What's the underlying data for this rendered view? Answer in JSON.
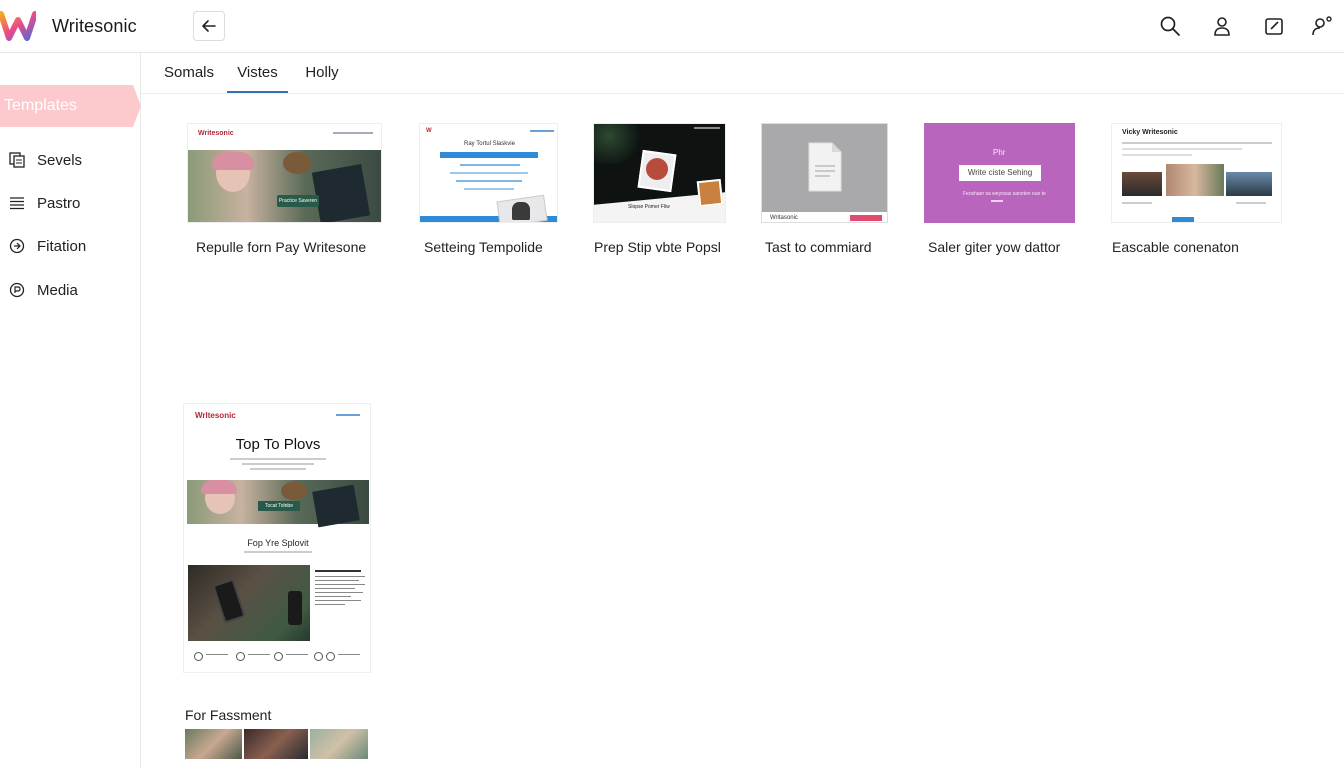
{
  "app": {
    "brand": "Writesonic",
    "brand_colors": [
      "#f6a623",
      "#e94a8b",
      "#4f6bd9"
    ]
  },
  "top_icons": [
    "search-icon",
    "user-icon",
    "edit-icon",
    "user-settings-icon"
  ],
  "sidebar": {
    "active_label": "Templates",
    "items": [
      {
        "label": "Sevels",
        "icon": "documents-icon"
      },
      {
        "label": "Pastro",
        "icon": "list-icon"
      },
      {
        "label": "Fitation",
        "icon": "compass-icon"
      },
      {
        "label": "Media",
        "icon": "media-icon"
      }
    ]
  },
  "tabs": [
    {
      "label": "Somals",
      "active": false
    },
    {
      "label": "Vistes",
      "active": true
    },
    {
      "label": "Holly",
      "active": false
    }
  ],
  "templates": [
    {
      "label": "Repulle forn Pay Writesone",
      "thumb_brand": "Writesonic",
      "thumb_button": "Practice Saveren"
    },
    {
      "label": "Setteing Tempolide",
      "thumb_title": "Ray Tortul Slaskvie"
    },
    {
      "label": "Prep Stip vbte Popsl",
      "thumb_caption": "Slopse Pomer Fliw"
    },
    {
      "label": "Tast to commiard",
      "thumb_footer": "Writasonic"
    },
    {
      "label": "Saler giter yow dattor",
      "thumb_top": "Phr",
      "thumb_box": "Write ciste Sehing",
      "thumb_caption": "Feoshaer sa weyssas sanoten oue te"
    },
    {
      "label": "Eascable conenaton",
      "thumb_brand": "Vicky Writesonic"
    }
  ],
  "feature_card": {
    "brand": "Wrltesonic",
    "title": "Top To Plovs",
    "subtitle": "Fop Yre Splovit",
    "button": "Tocat Tolnbe"
  },
  "section": {
    "title": "For Fassment"
  }
}
